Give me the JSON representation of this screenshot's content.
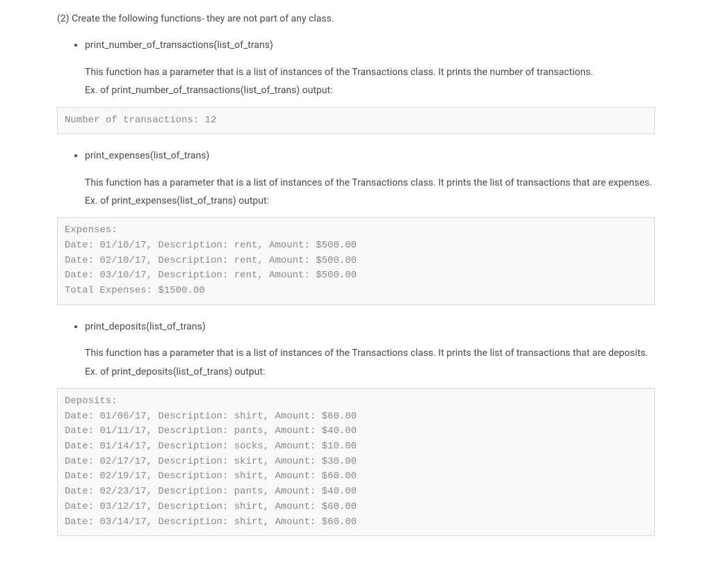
{
  "intro": "(2) Create the following functions- they are not part of any class.",
  "functions": [
    {
      "name": "print_number_of_transactions(list_of_trans)",
      "desc": "This function has a parameter that is a list of instances of the Transactions class. It prints the number of transactions.",
      "ex_label": "Ex. of print_number_of_transactions(list_of_trans) output:",
      "output": "Number of transactions: 12"
    },
    {
      "name": "print_expenses(list_of_trans)",
      "desc": "This function has a parameter that is a list of instances of the Transactions class. It prints the list of transactions that are expenses.",
      "ex_label": "Ex. of print_expenses(list_of_trans) output:",
      "output": "Expenses:\nDate: 01/10/17, Description: rent, Amount: $500.00\nDate: 02/10/17, Description: rent, Amount: $500.00\nDate: 03/10/17, Description: rent, Amount: $500.00\nTotal Expenses: $1500.00"
    },
    {
      "name": "print_deposits(list_of_trans)",
      "desc": "This function has a parameter that is a list of instances of the Transactions class. It prints the list of transactions that are deposits.",
      "ex_label": "Ex. of print_deposits(list_of_trans) output:",
      "output": "Deposits:\nDate: 01/06/17, Description: shirt, Amount: $60.00\nDate: 01/11/17, Description: pants, Amount: $40.00\nDate: 01/14/17, Description: socks, Amount: $10.00\nDate: 02/17/17, Description: skirt, Amount: $30.00\nDate: 02/19/17, Description: shirt, Amount: $60.00\nDate: 02/23/17, Description: pants, Amount: $40.00\nDate: 03/12/17, Description: shirt, Amount: $60.00\nDate: 03/14/17, Description: shirt, Amount: $60.00"
    }
  ]
}
